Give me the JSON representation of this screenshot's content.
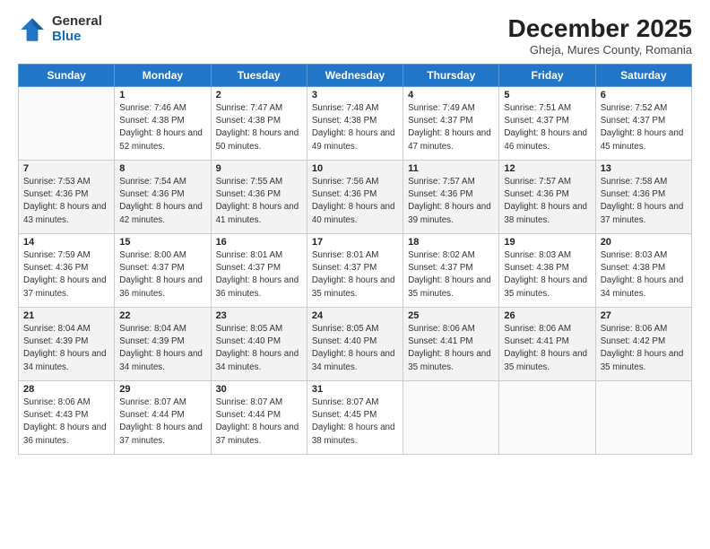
{
  "logo": {
    "general": "General",
    "blue": "Blue"
  },
  "header": {
    "month": "December 2025",
    "location": "Gheja, Mures County, Romania"
  },
  "weekdays": [
    "Sunday",
    "Monday",
    "Tuesday",
    "Wednesday",
    "Thursday",
    "Friday",
    "Saturday"
  ],
  "weeks": [
    [
      {
        "day": "",
        "sunrise": "",
        "sunset": "",
        "daylight": ""
      },
      {
        "day": "1",
        "sunrise": "Sunrise: 7:46 AM",
        "sunset": "Sunset: 4:38 PM",
        "daylight": "Daylight: 8 hours and 52 minutes."
      },
      {
        "day": "2",
        "sunrise": "Sunrise: 7:47 AM",
        "sunset": "Sunset: 4:38 PM",
        "daylight": "Daylight: 8 hours and 50 minutes."
      },
      {
        "day": "3",
        "sunrise": "Sunrise: 7:48 AM",
        "sunset": "Sunset: 4:38 PM",
        "daylight": "Daylight: 8 hours and 49 minutes."
      },
      {
        "day": "4",
        "sunrise": "Sunrise: 7:49 AM",
        "sunset": "Sunset: 4:37 PM",
        "daylight": "Daylight: 8 hours and 47 minutes."
      },
      {
        "day": "5",
        "sunrise": "Sunrise: 7:51 AM",
        "sunset": "Sunset: 4:37 PM",
        "daylight": "Daylight: 8 hours and 46 minutes."
      },
      {
        "day": "6",
        "sunrise": "Sunrise: 7:52 AM",
        "sunset": "Sunset: 4:37 PM",
        "daylight": "Daylight: 8 hours and 45 minutes."
      }
    ],
    [
      {
        "day": "7",
        "sunrise": "Sunrise: 7:53 AM",
        "sunset": "Sunset: 4:36 PM",
        "daylight": "Daylight: 8 hours and 43 minutes."
      },
      {
        "day": "8",
        "sunrise": "Sunrise: 7:54 AM",
        "sunset": "Sunset: 4:36 PM",
        "daylight": "Daylight: 8 hours and 42 minutes."
      },
      {
        "day": "9",
        "sunrise": "Sunrise: 7:55 AM",
        "sunset": "Sunset: 4:36 PM",
        "daylight": "Daylight: 8 hours and 41 minutes."
      },
      {
        "day": "10",
        "sunrise": "Sunrise: 7:56 AM",
        "sunset": "Sunset: 4:36 PM",
        "daylight": "Daylight: 8 hours and 40 minutes."
      },
      {
        "day": "11",
        "sunrise": "Sunrise: 7:57 AM",
        "sunset": "Sunset: 4:36 PM",
        "daylight": "Daylight: 8 hours and 39 minutes."
      },
      {
        "day": "12",
        "sunrise": "Sunrise: 7:57 AM",
        "sunset": "Sunset: 4:36 PM",
        "daylight": "Daylight: 8 hours and 38 minutes."
      },
      {
        "day": "13",
        "sunrise": "Sunrise: 7:58 AM",
        "sunset": "Sunset: 4:36 PM",
        "daylight": "Daylight: 8 hours and 37 minutes."
      }
    ],
    [
      {
        "day": "14",
        "sunrise": "Sunrise: 7:59 AM",
        "sunset": "Sunset: 4:36 PM",
        "daylight": "Daylight: 8 hours and 37 minutes."
      },
      {
        "day": "15",
        "sunrise": "Sunrise: 8:00 AM",
        "sunset": "Sunset: 4:37 PM",
        "daylight": "Daylight: 8 hours and 36 minutes."
      },
      {
        "day": "16",
        "sunrise": "Sunrise: 8:01 AM",
        "sunset": "Sunset: 4:37 PM",
        "daylight": "Daylight: 8 hours and 36 minutes."
      },
      {
        "day": "17",
        "sunrise": "Sunrise: 8:01 AM",
        "sunset": "Sunset: 4:37 PM",
        "daylight": "Daylight: 8 hours and 35 minutes."
      },
      {
        "day": "18",
        "sunrise": "Sunrise: 8:02 AM",
        "sunset": "Sunset: 4:37 PM",
        "daylight": "Daylight: 8 hours and 35 minutes."
      },
      {
        "day": "19",
        "sunrise": "Sunrise: 8:03 AM",
        "sunset": "Sunset: 4:38 PM",
        "daylight": "Daylight: 8 hours and 35 minutes."
      },
      {
        "day": "20",
        "sunrise": "Sunrise: 8:03 AM",
        "sunset": "Sunset: 4:38 PM",
        "daylight": "Daylight: 8 hours and 34 minutes."
      }
    ],
    [
      {
        "day": "21",
        "sunrise": "Sunrise: 8:04 AM",
        "sunset": "Sunset: 4:39 PM",
        "daylight": "Daylight: 8 hours and 34 minutes."
      },
      {
        "day": "22",
        "sunrise": "Sunrise: 8:04 AM",
        "sunset": "Sunset: 4:39 PM",
        "daylight": "Daylight: 8 hours and 34 minutes."
      },
      {
        "day": "23",
        "sunrise": "Sunrise: 8:05 AM",
        "sunset": "Sunset: 4:40 PM",
        "daylight": "Daylight: 8 hours and 34 minutes."
      },
      {
        "day": "24",
        "sunrise": "Sunrise: 8:05 AM",
        "sunset": "Sunset: 4:40 PM",
        "daylight": "Daylight: 8 hours and 34 minutes."
      },
      {
        "day": "25",
        "sunrise": "Sunrise: 8:06 AM",
        "sunset": "Sunset: 4:41 PM",
        "daylight": "Daylight: 8 hours and 35 minutes."
      },
      {
        "day": "26",
        "sunrise": "Sunrise: 8:06 AM",
        "sunset": "Sunset: 4:41 PM",
        "daylight": "Daylight: 8 hours and 35 minutes."
      },
      {
        "day": "27",
        "sunrise": "Sunrise: 8:06 AM",
        "sunset": "Sunset: 4:42 PM",
        "daylight": "Daylight: 8 hours and 35 minutes."
      }
    ],
    [
      {
        "day": "28",
        "sunrise": "Sunrise: 8:06 AM",
        "sunset": "Sunset: 4:43 PM",
        "daylight": "Daylight: 8 hours and 36 minutes."
      },
      {
        "day": "29",
        "sunrise": "Sunrise: 8:07 AM",
        "sunset": "Sunset: 4:44 PM",
        "daylight": "Daylight: 8 hours and 37 minutes."
      },
      {
        "day": "30",
        "sunrise": "Sunrise: 8:07 AM",
        "sunset": "Sunset: 4:44 PM",
        "daylight": "Daylight: 8 hours and 37 minutes."
      },
      {
        "day": "31",
        "sunrise": "Sunrise: 8:07 AM",
        "sunset": "Sunset: 4:45 PM",
        "daylight": "Daylight: 8 hours and 38 minutes."
      },
      {
        "day": "",
        "sunrise": "",
        "sunset": "",
        "daylight": ""
      },
      {
        "day": "",
        "sunrise": "",
        "sunset": "",
        "daylight": ""
      },
      {
        "day": "",
        "sunrise": "",
        "sunset": "",
        "daylight": ""
      }
    ]
  ]
}
